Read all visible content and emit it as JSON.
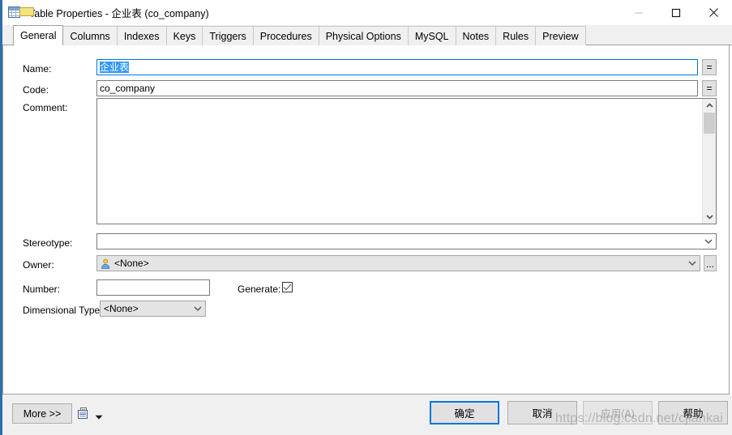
{
  "window": {
    "title": "Table Properties - 企业表 (co_company)",
    "icon": "table-icon",
    "controls": {
      "minimize": "–",
      "maximize": "□",
      "close": "✕"
    }
  },
  "tabs": [
    {
      "label": "General",
      "active": true
    },
    {
      "label": "Columns",
      "active": false
    },
    {
      "label": "Indexes",
      "active": false
    },
    {
      "label": "Keys",
      "active": false
    },
    {
      "label": "Triggers",
      "active": false
    },
    {
      "label": "Procedures",
      "active": false
    },
    {
      "label": "Physical Options",
      "active": false
    },
    {
      "label": "MySQL",
      "active": false
    },
    {
      "label": "Notes",
      "active": false
    },
    {
      "label": "Rules",
      "active": false
    },
    {
      "label": "Preview",
      "active": false
    }
  ],
  "form": {
    "name": {
      "label": "Name:",
      "value": "企业表",
      "selected": true,
      "button_label": "="
    },
    "code": {
      "label": "Code:",
      "value": "co_company",
      "button_label": "="
    },
    "comment": {
      "label": "Comment:",
      "value": ""
    },
    "stereotype": {
      "label": "Stereotype:",
      "value": ""
    },
    "owner": {
      "label": "Owner:",
      "value": "<None>",
      "icon": "person-icon",
      "browse_label": "..."
    },
    "number": {
      "label": "Number:",
      "value": ""
    },
    "generate": {
      "label": "Generate:",
      "checked": true
    },
    "dimensional_type": {
      "label": "Dimensional Type:",
      "value": "<None>"
    }
  },
  "footer": {
    "more_label": "More >>",
    "report_icon": "report-icon",
    "dropdown_icon": "chevron-down-icon",
    "ok_label": "确定",
    "cancel_label": "取消",
    "apply_label": "应用(A)",
    "apply_disabled": true,
    "help_label": "帮助"
  },
  "watermark": {
    "text": "https://blog.csdn.net/cjiankai"
  },
  "colors": {
    "accent": "#0078d7",
    "selection": "#3399ff",
    "panel_border": "#a0a0a0",
    "footer_bg": "#f0f0f0"
  }
}
